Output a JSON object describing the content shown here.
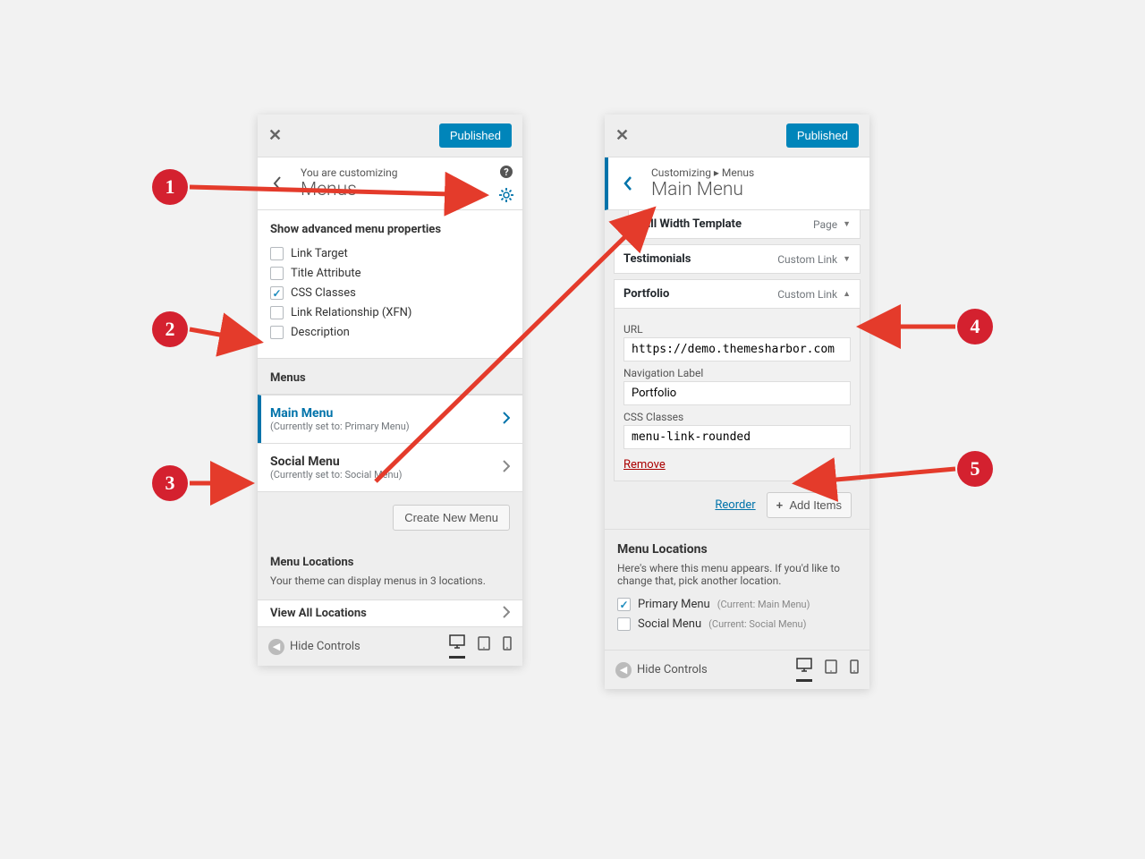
{
  "panel1": {
    "publish_label": "Published",
    "breadcrumb_pre": "You are customizing",
    "title": "Menus",
    "advanced_title": "Show advanced menu properties",
    "props": {
      "link_target": "Link Target",
      "title_attr": "Title Attribute",
      "css_classes": "CSS Classes",
      "link_rel": "Link Relationship (XFN)",
      "description": "Description"
    },
    "menus_label": "Menus",
    "menu_list": {
      "main": {
        "name": "Main Menu",
        "sub": "(Currently set to: Primary Menu)"
      },
      "social": {
        "name": "Social Menu",
        "sub": "(Currently set to: Social Menu)"
      }
    },
    "create_btn": "Create New Menu",
    "loc_head": "Menu Locations",
    "loc_desc": "Your theme can display menus in 3 locations.",
    "view_all": "View All Locations",
    "hide_controls": "Hide Controls"
  },
  "panel2": {
    "publish_label": "Published",
    "breadcrumb_pre": "Customizing ▸ Menus",
    "title": "Main Menu",
    "items": {
      "fw": {
        "label": "Full Width Template",
        "type": "Page"
      },
      "testi": {
        "label": "Testimonials",
        "type": "Custom Link"
      },
      "portfolio": {
        "label": "Portfolio",
        "type": "Custom Link"
      }
    },
    "portfolio_fields": {
      "url_label": "URL",
      "url_value": "https://demo.themesharbor.com",
      "nav_label_label": "Navigation Label",
      "nav_label_value": "Portfolio",
      "css_label": "CSS Classes",
      "css_value": "menu-link-rounded",
      "remove": "Remove"
    },
    "reorder": "Reorder",
    "add_items": "Add Items",
    "loc_head": "Menu Locations",
    "loc_desc": "Here's where this menu appears. If you'd like to change that, pick another location.",
    "loc_primary": "Primary Menu",
    "loc_primary_cur": "(Current: Main Menu)",
    "loc_social": "Social Menu",
    "loc_social_cur": "(Current: Social Menu)",
    "hide_controls": "Hide Controls"
  },
  "callouts": {
    "1": "1",
    "2": "2",
    "3": "3",
    "4": "4",
    "5": "5"
  }
}
